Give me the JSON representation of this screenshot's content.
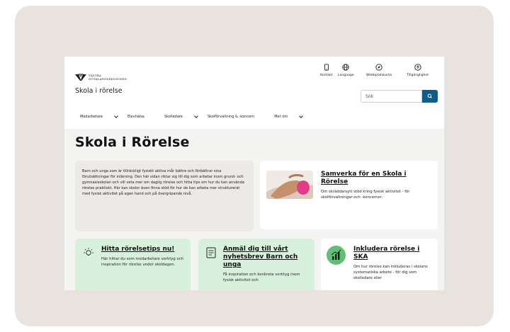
{
  "header": {
    "logo_text_line1": "VÄSTRA",
    "logo_text_line2": "GÖTALANDSREGIONEN",
    "site_title": "Skola i rörelse",
    "utilities": [
      {
        "label": "Kontakt",
        "icon": "phone-icon"
      },
      {
        "label": "Language",
        "icon": "globe-icon"
      },
      {
        "label": "Webbplatskarta",
        "icon": "compass-icon"
      },
      {
        "label": "Tillgänglighet",
        "icon": "accessibility-icon"
      }
    ],
    "search": {
      "placeholder": "Sök",
      "button_icon": "search-icon"
    }
  },
  "nav": {
    "items": [
      {
        "label": "Medarbetare",
        "has_dropdown": true
      },
      {
        "label": "Elevhälsa",
        "has_dropdown": false
      },
      {
        "label": "Skolledare",
        "has_dropdown": true
      },
      {
        "label": "Skolförvaltning & -koncern",
        "has_dropdown": false
      },
      {
        "label": "Mer om",
        "has_dropdown": true
      }
    ]
  },
  "main": {
    "title": "Skola i Rörelse",
    "intro": "Barn och unga som är tillräckligt fysiskt aktiva mår bättre och förbättrar sina förutsättningar för inlärning. Den här sidan riktar sig till dig som arbetar inom grund- och gymnasieskolan och vill veta mer om daglig rörelse och hitta tips om hur du kan använda rörelse praktiskt. Här kan skolor även finna stöd för hur de kan arbeta mer strukturerat med fysisk aktivitet på egen hand och på övergripande nivå.",
    "featured": {
      "title": "Samverka för en Skola i Rörelse",
      "text": "Om skräddarsytt stöd kring fysisk aktivitet - för skolförvaltningar och -koncerner."
    },
    "cards": [
      {
        "title": "Hitta rörelsetips nu!",
        "text": "Här hittar du som medarbetare verktyg och inspiration för rörelse under skoldagen.",
        "icon": "lightbulb-icon"
      },
      {
        "title": "Anmäl dig till vårt nyhetsbrev Barn och unga",
        "text": "Få inspiration och konkreta verktyg inom fysisk aktivitet och",
        "icon": "document-icon"
      },
      {
        "title": "Inkludera rörelse i SKA",
        "text": "Om hur rörelse kan inkluderas i skolans systematiska arbete - för dig som skolledare eller",
        "icon": "growth-chart-icon"
      }
    ]
  },
  "colors": {
    "frame": "#e9e3df",
    "accent_blue": "#0b5f8a",
    "card_green": "#d8f1dd",
    "icon_green": "#5fc176"
  }
}
